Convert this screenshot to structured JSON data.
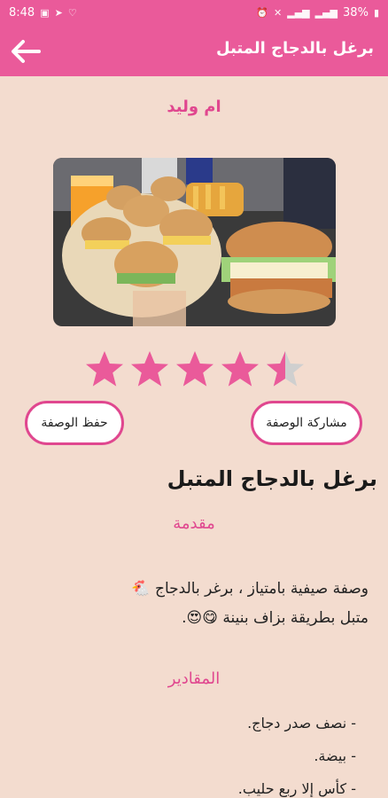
{
  "status": {
    "time": "8:48",
    "battery": "38%"
  },
  "appbar": {
    "title": "برغل بالدجاج المتبل"
  },
  "author": "ام وليد",
  "rating": {
    "value": 4.5,
    "max": 5
  },
  "buttons": {
    "save": "حفظ الوصفة",
    "share": "مشاركة الوصفة"
  },
  "recipe": {
    "title": "برغل بالدجاج المتبل",
    "intro_heading": "مقدمة",
    "intro_line1": "وصفة صيفية بامتياز ، برغر بالدجاج 🐔",
    "intro_line2": "متبل بطريقة بزاف بنينة 😋😍.",
    "ingredients_heading": "المقادير",
    "ingredients": [
      "- نصف صدر دجاج.",
      "- بيضة.",
      "- كأس إلا ربع حليب."
    ]
  },
  "colors": {
    "accent": "#ea5a9a",
    "accent_dark": "#e0478f",
    "background": "#f3dccf"
  }
}
